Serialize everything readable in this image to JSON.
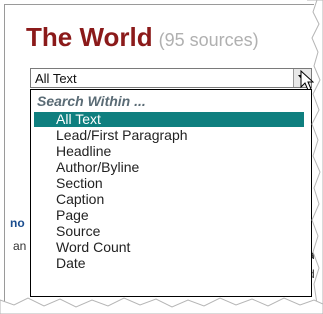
{
  "header": {
    "title": "The World",
    "subtitle": "(95 sources)"
  },
  "search_select": {
    "value": "All Text"
  },
  "dropdown": {
    "group_label": "Search Within ...",
    "options": [
      "All Text",
      "Lead/First Paragraph",
      "Headline",
      "Author/Byline",
      "Section",
      "Caption",
      "Page",
      "Source",
      "Word Count",
      "Date"
    ],
    "selected": "All Text"
  },
  "colors": {
    "title": "#8b1a1a",
    "subtitle": "#b0b0b0",
    "highlight": "#0f7f7f",
    "group_label": "#5a6b75"
  }
}
